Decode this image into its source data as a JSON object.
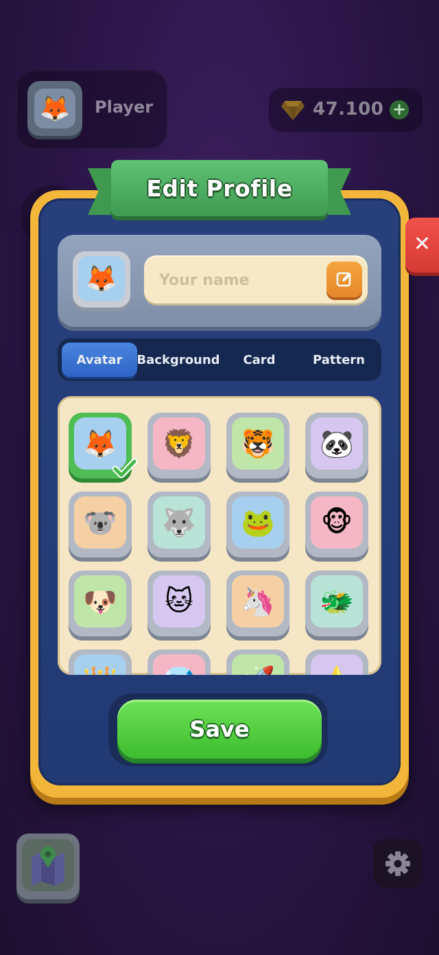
{
  "hud": {
    "player_name": "Player",
    "player_avatar_icon": "🦊",
    "gems_value": "47.100",
    "gems_plus": "+"
  },
  "modal": {
    "title": "Edit Profile",
    "close_label": "✕",
    "avatar_icon": "🦊",
    "name_placeholder": "Your name",
    "tabs": [
      {
        "label": "Avatar",
        "active": true
      },
      {
        "label": "Background",
        "active": false
      },
      {
        "label": "Card",
        "active": false
      },
      {
        "label": "Pattern",
        "active": false
      }
    ],
    "avatars": [
      {
        "emoji": "🦊",
        "bg": "#a7d0ee",
        "selected": true
      },
      {
        "emoji": "🦁",
        "bg": "#f5b7c6",
        "selected": false
      },
      {
        "emoji": "🐯",
        "bg": "#bfe6a8",
        "selected": false
      },
      {
        "emoji": "🐼",
        "bg": "#d5c7f0",
        "selected": false
      },
      {
        "emoji": "🐨",
        "bg": "#f5d0a5",
        "selected": false
      },
      {
        "emoji": "🐺",
        "bg": "#b9e3d7",
        "selected": false
      },
      {
        "emoji": "🐸",
        "bg": "#a7d0ee",
        "selected": false
      },
      {
        "emoji": "🐵",
        "bg": "#f5b7c6",
        "selected": false
      },
      {
        "emoji": "🐶",
        "bg": "#bfe6a8",
        "selected": false
      },
      {
        "emoji": "🐱",
        "bg": "#d5c7f0",
        "selected": false
      },
      {
        "emoji": "🦄",
        "bg": "#f5d0a5",
        "selected": false
      },
      {
        "emoji": "🐲",
        "bg": "#b9e3d7",
        "selected": false
      },
      {
        "emoji": "👑",
        "bg": "#a7d0ee",
        "selected": false
      },
      {
        "emoji": "💎",
        "bg": "#f5b7c6",
        "selected": false
      },
      {
        "emoji": "🚀",
        "bg": "#bfe6a8",
        "selected": false
      },
      {
        "emoji": "⭐",
        "bg": "#d5c7f0",
        "selected": false
      }
    ],
    "save_label": "Save"
  },
  "colors": {
    "modal_border": "#f2b63a",
    "modal_body": "#27407c",
    "ribbon": "#4caf5f",
    "save_button": "#4cc93b",
    "close_button": "#e5453e",
    "active_tab": "#3a72d4"
  }
}
